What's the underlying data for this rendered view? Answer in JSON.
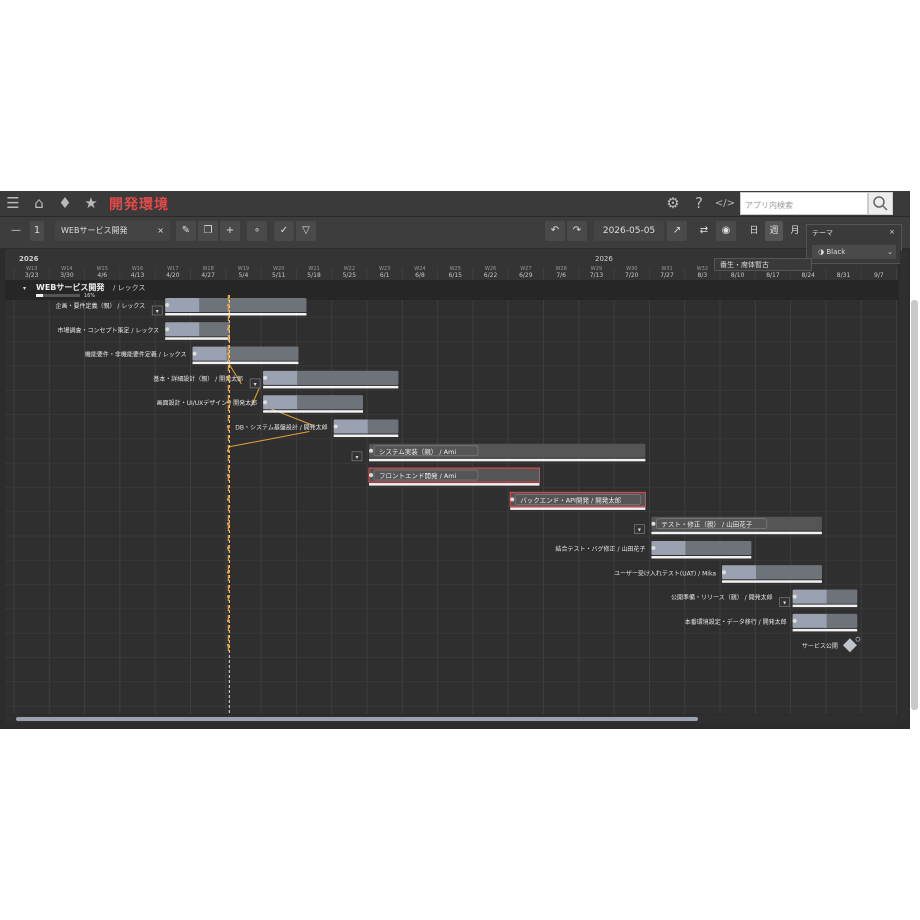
{
  "header": {
    "title": "開発環境",
    "search_placeholder": "アプリ内検索"
  },
  "toolbar": {
    "level": "1",
    "project_name": "WEBサービス開発",
    "close_glyph": "×",
    "date": "2026-05-05",
    "scale_day": "日",
    "scale_week": "週",
    "scale_month": "月"
  },
  "theme_panel": {
    "title": "テーマ",
    "close_glyph": "×",
    "selected": "◑ Black"
  },
  "baseline_popup": {
    "label": "番生・席体暫古"
  },
  "timeline": {
    "year_left": "2026",
    "year_center": "2026",
    "weeks": [
      {
        "w": "W13",
        "d": "3/23"
      },
      {
        "w": "W14",
        "d": "3/30"
      },
      {
        "w": "W15",
        "d": "4/6"
      },
      {
        "w": "W16",
        "d": "4/13"
      },
      {
        "w": "W17",
        "d": "4/20"
      },
      {
        "w": "W18",
        "d": "4/27"
      },
      {
        "w": "W19",
        "d": "5/4"
      },
      {
        "w": "W20",
        "d": "5/11"
      },
      {
        "w": "W21",
        "d": "5/18"
      },
      {
        "w": "W22",
        "d": "5/25"
      },
      {
        "w": "W23",
        "d": "6/1"
      },
      {
        "w": "W24",
        "d": "6/8"
      },
      {
        "w": "W25",
        "d": "6/15"
      },
      {
        "w": "W26",
        "d": "6/22"
      },
      {
        "w": "W27",
        "d": "6/29"
      },
      {
        "w": "W28",
        "d": "7/6"
      },
      {
        "w": "W29",
        "d": "7/13"
      },
      {
        "w": "W30",
        "d": "7/20"
      },
      {
        "w": "W31",
        "d": "7/27"
      },
      {
        "w": "W32",
        "d": "8/3"
      },
      {
        "w": "",
        "d": "8/10"
      },
      {
        "w": "",
        "d": "8/17"
      },
      {
        "w": "",
        "d": "8/24"
      },
      {
        "w": "",
        "d": "8/31"
      },
      {
        "w": "",
        "d": "9/7"
      }
    ]
  },
  "project": {
    "name": "WEBサービス開発",
    "owner": "/ レックス",
    "progress_label": "16%",
    "progress": 0.16
  },
  "tasks": [
    {
      "label": "企画・要件定義（親） / レックス",
      "start": 4,
      "end": 8,
      "parent": true,
      "state": "normal"
    },
    {
      "label": "市場調査・コンセプト策定 / レックス",
      "start": 4,
      "end": 6,
      "parent": false,
      "state": "normal"
    },
    {
      "label": "機能要件・非機能要件定義 / レックス",
      "start": 5,
      "end": 8,
      "parent": false,
      "state": "normal"
    },
    {
      "label": "基本・詳細設計（親） / 開発太郎",
      "start": 7,
      "end": 11,
      "parent": true,
      "state": "normal"
    },
    {
      "label": "画面設計・UI/UXデザイン / 開発太郎",
      "start": 7,
      "end": 10,
      "parent": false,
      "state": "normal"
    },
    {
      "label": "DB・システム基盤設計 / 開発太郎",
      "start": 9,
      "end": 11,
      "parent": false,
      "state": "normal"
    },
    {
      "label": "システム実装（親） / Ami",
      "start": 10,
      "end": 18,
      "parent": true,
      "state": "inside"
    },
    {
      "label": "フロントエンド開発 / Ami",
      "start": 10,
      "end": 15,
      "parent": false,
      "state": "inside-red"
    },
    {
      "label": "バックエンド・API開発 / 開発太郎",
      "start": 14,
      "end": 18,
      "parent": false,
      "state": "inside-red"
    },
    {
      "label": "テスト・修正（親） / 山田花子",
      "start": 18,
      "end": 23,
      "parent": true,
      "state": "inside"
    },
    {
      "label": "結合テスト・バグ修正 / 山田花子",
      "start": 18,
      "end": 21,
      "parent": false,
      "state": "normal"
    },
    {
      "label": "ユーザー受け入れテスト(UAT) / Mika",
      "start": 20,
      "end": 23,
      "parent": false,
      "state": "normal"
    },
    {
      "label": "公開準備・リリース（親） / 開発太郎",
      "start": 22,
      "end": 24,
      "parent": true,
      "state": "normal"
    },
    {
      "label": "本番環境設定・データ移行 / 開発太郎",
      "start": 22,
      "end": 24,
      "parent": false,
      "state": "normal"
    },
    {
      "label": "サービス公開",
      "start": 23,
      "end": 23,
      "parent": false,
      "state": "milestone"
    }
  ],
  "today_col": 6.1,
  "colors": {
    "accent": "#e04a4a",
    "bar": "#9aa2b2",
    "bar_dark": "#555555",
    "dependency": "#e8a33a",
    "critical": "#d9444c"
  }
}
